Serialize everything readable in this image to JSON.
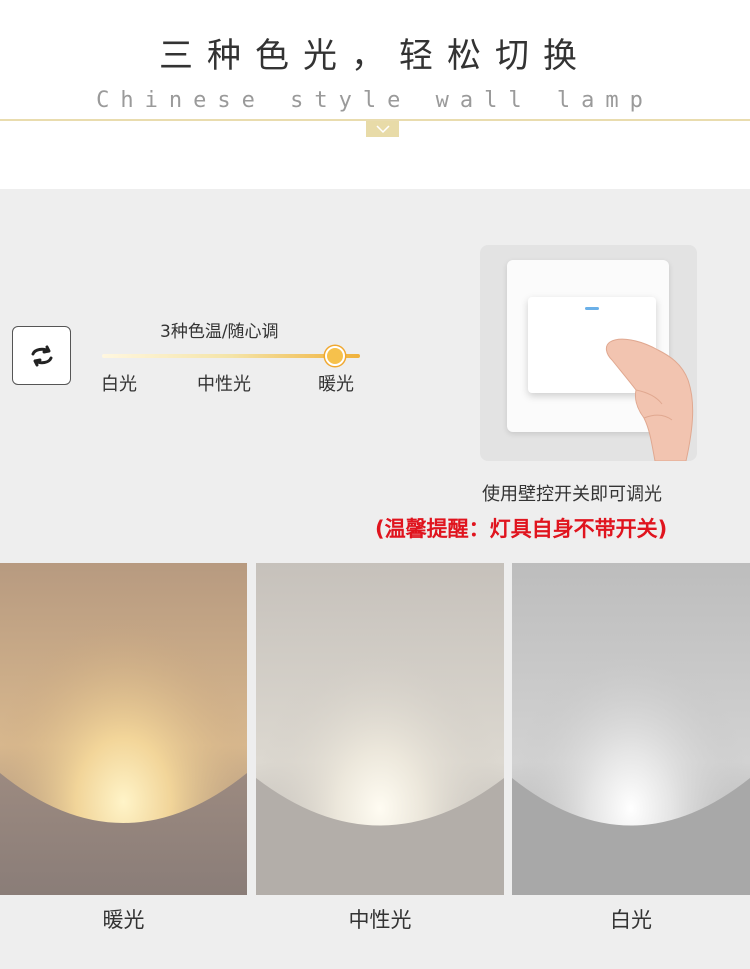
{
  "header": {
    "title": "三种色光，轻松切换",
    "subtitle": "Chinese style wall lamp"
  },
  "temperature": {
    "label": "3种色温/随心调",
    "options": [
      "白光",
      "中性光",
      "暖光"
    ],
    "selected": "暖光"
  },
  "switch": {
    "caption": "使用壁控开关即可调光",
    "warning": "(温馨提醒：灯具自身不带开关)"
  },
  "panels": [
    {
      "label": "暖光",
      "tone": "warm"
    },
    {
      "label": "中性光",
      "tone": "neutral"
    },
    {
      "label": "白光",
      "tone": "white"
    }
  ],
  "colors": {
    "accent_gold": "#e8dba8",
    "warning_red": "#e0141e",
    "knob": "#f6c14c"
  },
  "icons": [
    "chevron-down-icon",
    "swap-arrows-icon",
    "wall-switch-image",
    "hand-image"
  ]
}
